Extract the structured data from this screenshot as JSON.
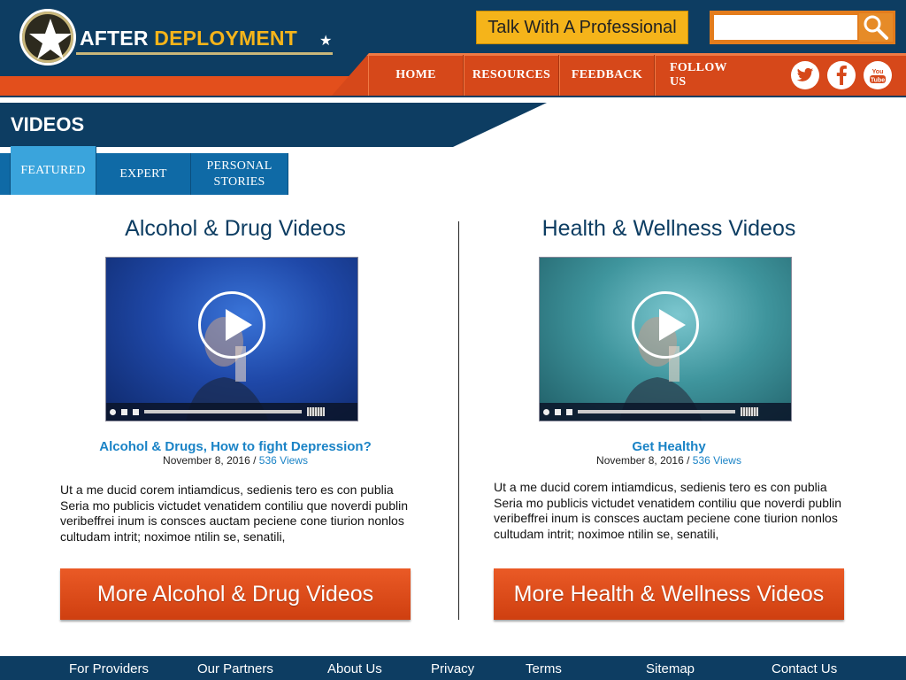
{
  "brand": {
    "name_part1": "AFTER",
    "name_part2": "DEPLOYMENT",
    "accent": "#f5b41a",
    "navy": "#0d3d62",
    "orange": "#e34f1c"
  },
  "header": {
    "talk_button": "Talk With A Professional",
    "search": {
      "value": "",
      "placeholder": ""
    },
    "nav": [
      "HOME",
      "RESOURCES",
      "FEEDBACK",
      "FOLLOW US"
    ],
    "social_icons": [
      "twitter-icon",
      "facebook-icon",
      "youtube-icon"
    ]
  },
  "page": {
    "title": "VIDEOS"
  },
  "tabs": [
    "FEATURED",
    "EXPERT",
    "PERSONAL STORIES"
  ],
  "active_tab": "FEATURED",
  "columns": [
    {
      "heading": "Alcohol & Drug Videos",
      "video_title": "Alcohol & Drugs, How to fight Depression?",
      "date": "November 8,  2016 /",
      "views": "536 Views",
      "description": "Ut a me ducid corem intiamdicus, sedienis tero es con publia Seria mo publicis victudet venatidem contiliu que noverdi publin veribeffrei inum is consces auctam peciene cone tiurion nonlos cultudam intrit; noximoe ntilin se, senatili,",
      "button": "More Alcohol & Drug Videos"
    },
    {
      "heading": "Health & Wellness Videos",
      "video_title": "Get Healthy",
      "date": "November 8,  2016 /",
      "views": "536 Views",
      "description": "Ut a me ducid corem intiamdicus, sedienis tero es con publia Seria mo publicis victudet venatidem contiliu que noverdi publin veribeffrei inum is consces auctam peciene cone tiurion nonlos cultudam intrit; noximoe ntilin se, senatili,",
      "button": "More Health & Wellness Videos"
    }
  ],
  "footer": [
    "For Providers",
    "Our Partners",
    "About Us",
    "Privacy",
    "Terms",
    "Sitemap",
    "Contact Us"
  ]
}
